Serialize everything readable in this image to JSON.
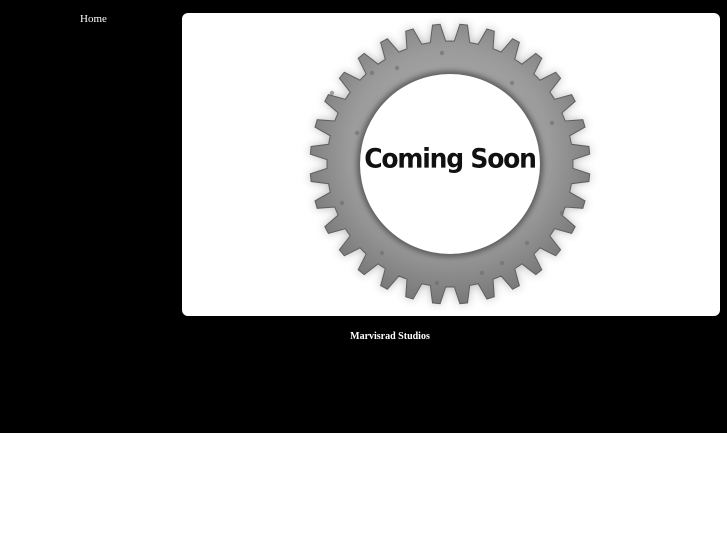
{
  "nav": {
    "home_label": "Home"
  },
  "banner": {
    "headline": "Coming Soon",
    "graphic_icon": "gear-icon"
  },
  "footer": {
    "studio_name": "Marvisrad Studios"
  },
  "colors": {
    "background": "#000000",
    "banner_background": "#ffffff",
    "gear_metal": "#8f8f8f",
    "text_light": "#ffffff",
    "text_dark": "#111111"
  }
}
